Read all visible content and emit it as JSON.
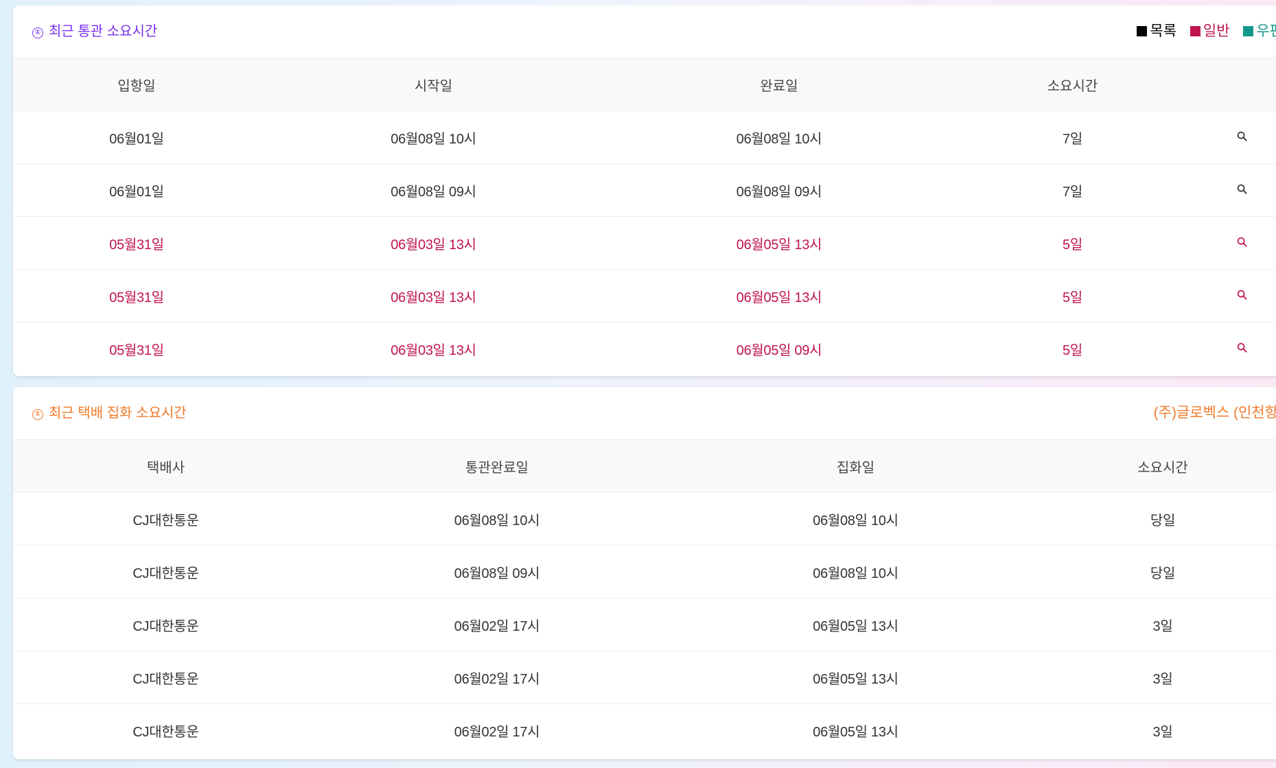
{
  "clearance": {
    "title": "최근 통관 소요시간",
    "info_icon": "①",
    "legend": [
      {
        "label": "목록",
        "color": "#000000"
      },
      {
        "label": "일반",
        "color": "#c1134f"
      },
      {
        "label": "우편",
        "color": "#13998a"
      }
    ],
    "columns": [
      "입항일",
      "시작일",
      "완료일",
      "소요시간"
    ],
    "rows": [
      {
        "type": "list",
        "arrival": "06월01일",
        "start": "06월08일 10시",
        "complete": "06월08일 10시",
        "duration": "7일"
      },
      {
        "type": "list",
        "arrival": "06월01일",
        "start": "06월08일 09시",
        "complete": "06월08일 09시",
        "duration": "7일"
      },
      {
        "type": "general",
        "arrival": "05월31일",
        "start": "06월03일 13시",
        "complete": "06월05일 13시",
        "duration": "5일"
      },
      {
        "type": "general",
        "arrival": "05월31일",
        "start": "06월03일 13시",
        "complete": "06월05일 13시",
        "duration": "5일"
      },
      {
        "type": "general",
        "arrival": "05월31일",
        "start": "06월03일 13시",
        "complete": "06월05일 09시",
        "duration": "5일"
      }
    ],
    "row_icon": "search-icon"
  },
  "pickup": {
    "title": "최근 택배 집화 소요시간",
    "info_icon": "①",
    "courier": "(주)글로벡스 (인천항)",
    "columns": [
      "택배사",
      "통관완료일",
      "집화일",
      "소요시간"
    ],
    "rows": [
      {
        "courier": "CJ대한통운",
        "cleared": "06월08일 10시",
        "pickup": "06월08일 10시",
        "duration": "당일"
      },
      {
        "courier": "CJ대한통운",
        "cleared": "06월08일 09시",
        "pickup": "06월08일 10시",
        "duration": "당일"
      },
      {
        "courier": "CJ대한통운",
        "cleared": "06월02일 17시",
        "pickup": "06월05일 13시",
        "duration": "3일"
      },
      {
        "courier": "CJ대한통운",
        "cleared": "06월02일 17시",
        "pickup": "06월05일 13시",
        "duration": "3일"
      },
      {
        "courier": "CJ대한통운",
        "cleared": "06월02일 17시",
        "pickup": "06월05일 13시",
        "duration": "3일"
      }
    ]
  },
  "colors": {
    "clearance_title": "#7a2ff0",
    "pickup_title": "#f07a2a",
    "general_row": "#c1134f",
    "list_row": "#333333"
  }
}
